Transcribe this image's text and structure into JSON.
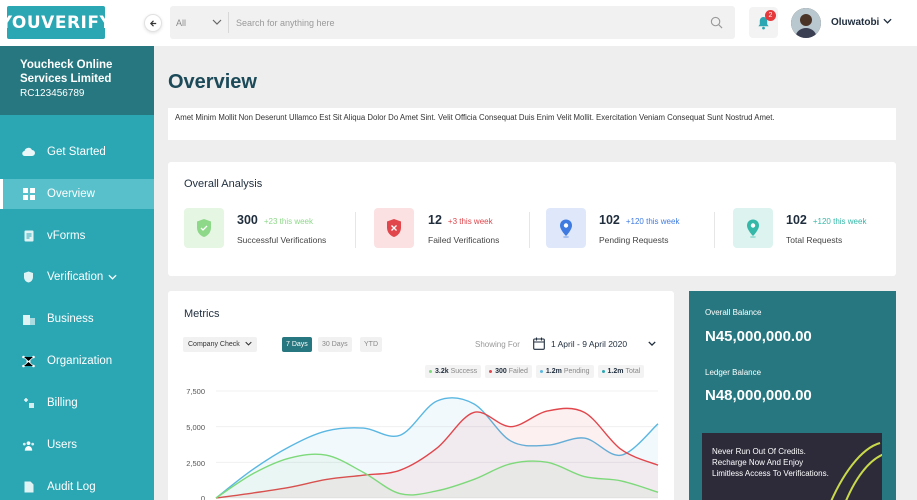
{
  "brand": {
    "logo_text": "YOUVERIFY"
  },
  "search": {
    "category": "All",
    "placeholder": "Search for anything here"
  },
  "notifications": {
    "count": "2"
  },
  "user": {
    "name": "Oluwatobi"
  },
  "company": {
    "name": "Youcheck Online Services Limited",
    "rc": "RC123456789"
  },
  "sidebar": {
    "items": [
      {
        "label": "Get Started",
        "icon": "cloud-icon"
      },
      {
        "label": "Overview",
        "icon": "grid-icon",
        "active": true
      },
      {
        "label": "vForms",
        "icon": "form-icon"
      },
      {
        "label": "Verification",
        "icon": "shield-icon"
      },
      {
        "label": "Business",
        "icon": "building-icon"
      },
      {
        "label": "Organization",
        "icon": "network-icon"
      },
      {
        "label": "Billing",
        "icon": "billing-icon"
      },
      {
        "label": "Users",
        "icon": "users-icon"
      },
      {
        "label": "Audit Log",
        "icon": "log-icon"
      }
    ]
  },
  "page": {
    "title": "Overview",
    "description": "Amet Minim Mollit Non Deserunt Ullamco Est Sit Aliqua Dolor Do Amet Sint. Velit Officia Consequat Duis Enim Velit Mollit. Exercitation Veniam Consequat Sunt Nostrud Amet."
  },
  "analysis": {
    "title": "Overall Analysis",
    "stats": [
      {
        "value": "300",
        "delta": "+23 this week",
        "label": "Successful Verifications",
        "color": "#8ed88a",
        "icon": "shield-check-icon"
      },
      {
        "value": "12",
        "delta": "+3 this week",
        "label": "Failed Verifications",
        "color": "#e0464b",
        "icon": "shield-x-icon"
      },
      {
        "value": "102",
        "delta": "+120 this week",
        "label": "Pending Requests",
        "color": "#3f7be0",
        "icon": "location-pin-icon"
      },
      {
        "value": "102",
        "delta": "+120 this week",
        "label": "Total  Requests",
        "color": "#35b8a8",
        "icon": "location-pin-icon"
      }
    ]
  },
  "metrics": {
    "title": "Metrics",
    "company_filter": "Company Check",
    "ranges": [
      "7 Days",
      "30 Days",
      "YTD"
    ],
    "showing_label": "Showing For",
    "date_from": "1 April",
    "date_sep": "-",
    "date_to": "9 April 2020",
    "legend": [
      {
        "value": "3.2k",
        "label": "Success",
        "color": "#7dd97a"
      },
      {
        "value": "300",
        "label": "Failed",
        "color": "#e0464b"
      },
      {
        "value": "1.2m",
        "label": "Pending",
        "color": "#5ab7e2"
      },
      {
        "value": "1.2m",
        "label": "Total",
        "color": "#2ba6b3"
      }
    ]
  },
  "chart_data": {
    "type": "line",
    "yticks": [
      "7,500",
      "5,000",
      "2,500",
      "0"
    ],
    "ylim": [
      0,
      7500
    ],
    "x": [
      0,
      1,
      2,
      3,
      4,
      5,
      6,
      7,
      8,
      9,
      10,
      11,
      12
    ],
    "series": [
      {
        "color": "#5ab7e2",
        "values": [
          0,
          2000,
          3600,
          4700,
          4900,
          4400,
          6800,
          6600,
          4000,
          3700,
          4200,
          3000,
          5200
        ]
      },
      {
        "color": "#e0464b",
        "values": [
          0,
          350,
          750,
          1300,
          1600,
          1950,
          3500,
          6000,
          5000,
          6100,
          6000,
          3400,
          2300
        ]
      },
      {
        "color": "#7dd97a",
        "values": [
          0,
          1700,
          2800,
          3000,
          1800,
          300,
          500,
          1300,
          2400,
          2500,
          1500,
          1200,
          400
        ]
      }
    ]
  },
  "balance": {
    "overall_label": "Overall Balance",
    "overall_value": "N45,000,000.00",
    "ledger_label": "Ledger Balance",
    "ledger_value": "N48,000,000.00",
    "promo_text": "Never Run Out Of Credits. Recharge Now And Enjoy Limitless Access To Verifications."
  }
}
